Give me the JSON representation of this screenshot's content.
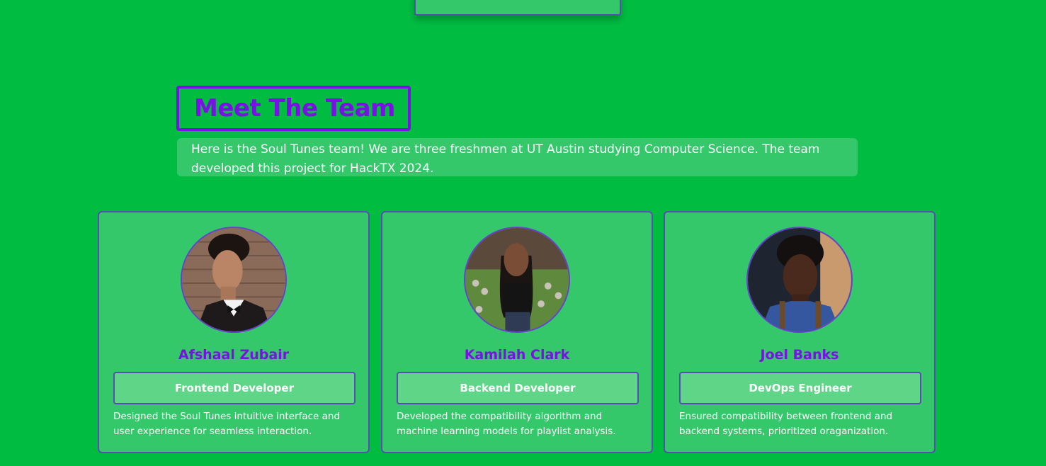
{
  "team": {
    "title": "Meet The Team",
    "intro": "Here is the Soul Tunes team! We are three freshmen at UT Austin studying Computer Science. The team developed this project for HackTX 2024.",
    "members": [
      {
        "name": "Afshaal Zubair",
        "role": "Frontend Developer",
        "description": "Designed the Soul Tunes intuitive interface and user experience for seamless interaction."
      },
      {
        "name": "Kamilah Clark",
        "role": "Backend Developer",
        "description": "Developed the compatibility algorithm and machine learning models for playlist analysis."
      },
      {
        "name": "Joel Banks",
        "role": "DevOps Engineer",
        "description": "Ensured compatibility between frontend and backend systems, prioritized oraganization."
      }
    ]
  },
  "colors": {
    "page_background": "#00bd42",
    "card_background": "#34c86b",
    "accent_purple": "#7a0fe6",
    "border_indigo": "#5a4bb5",
    "badge_background": "#5fd587"
  }
}
